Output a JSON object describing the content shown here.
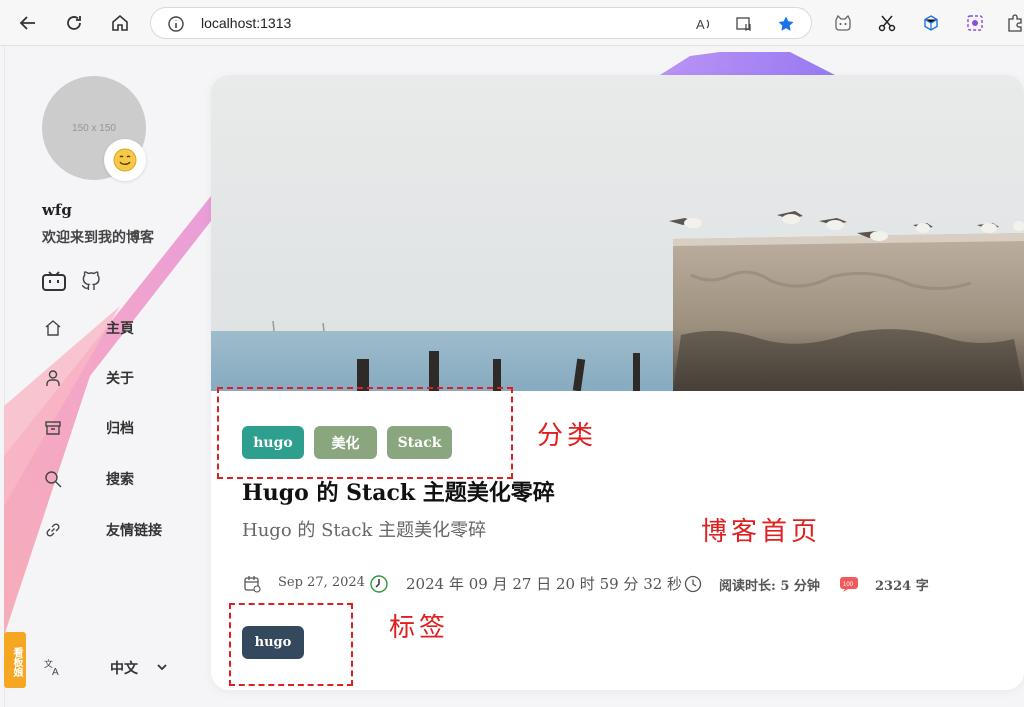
{
  "browser": {
    "url": "localhost:1313"
  },
  "sidebar": {
    "avatar_placeholder": "150 x 150",
    "avatar_emoji": "😊",
    "site_name": "wfg",
    "site_description": "欢迎来到我的博客",
    "social": [
      {
        "icon": "bilibili-icon"
      },
      {
        "icon": "github-icon"
      }
    ],
    "menu": [
      {
        "label": "主頁",
        "icon": "home-icon"
      },
      {
        "label": "关于",
        "icon": "user-icon"
      },
      {
        "label": "归档",
        "icon": "archive-icon"
      },
      {
        "label": "搜索",
        "icon": "search-icon"
      },
      {
        "label": "友情链接",
        "icon": "link-icon"
      }
    ],
    "language": "中文",
    "kanban_label": "看板娘"
  },
  "article": {
    "categories": [
      {
        "label": "hugo",
        "color": "#2e9e8f"
      },
      {
        "label": "美化",
        "color": "#8aa67f"
      },
      {
        "label": "Stack",
        "color": "#8aa67f"
      }
    ],
    "title": "Hugo 的 Stack 主题美化零碎",
    "subtitle": "Hugo 的 Stack 主题美化零碎",
    "date": "Sep 27, 2024",
    "datetime": "2024 年 09 月 27 日 20 时 59 分 32 秒",
    "reading_time": "阅读时长: 5 分钟",
    "word_count": "2324 字",
    "tags": [
      {
        "label": "hugo"
      }
    ]
  },
  "annotations": {
    "category": "分类",
    "homepage": "博客首页",
    "tag": "标签",
    "color": "#e02020"
  }
}
